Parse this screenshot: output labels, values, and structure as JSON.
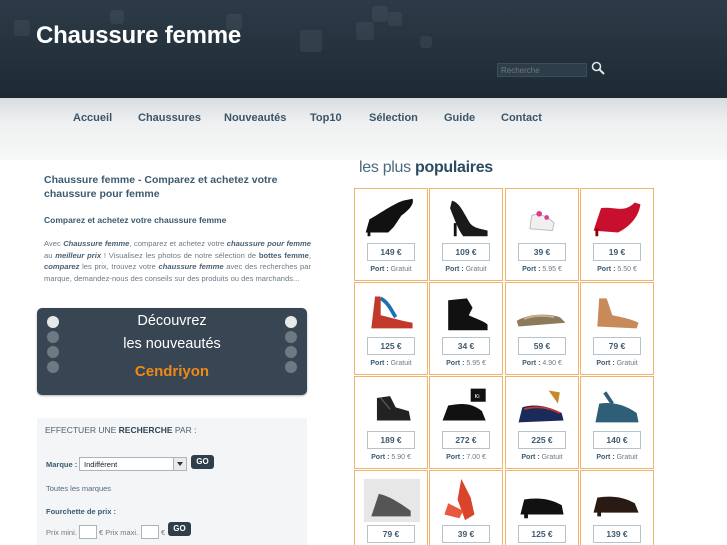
{
  "header": {
    "title": "Chaussure femme",
    "search_placeholder": "Recherche"
  },
  "nav": [
    "Accueil",
    "Chaussures",
    "Nouveautés",
    "Top10",
    "Sélection",
    "Guide",
    "Contact"
  ],
  "intro": {
    "title": "Chaussure femme - Comparez et achetez votre chaussure pour femme",
    "subtitle": "Comparez et achetez votre chaussure femme",
    "p1": "Avec ",
    "b1": "Chaussure femme",
    "p2": ", comparez et achetez votre ",
    "b2": "chaussure pour femme",
    "p3": " au ",
    "b3": "meilleur prix",
    "p4": " ! Visualisez les photos de notre sélection de ",
    "b4": "bottes femme",
    "p5": ", ",
    "b5": "comparez",
    "p6": " les prix, trouvez votre ",
    "b6": "chaussure femme",
    "p7": " avec des recherches par marque, demandez-nous des conseils sur des produits ou des marchands..."
  },
  "promo": {
    "line1": "Découvrez",
    "line2": "les nouveautés",
    "brand": "Cendriyon"
  },
  "search_panel": {
    "title_pre": "EFFECTUER UNE ",
    "title_bold": "RECHERCHE",
    "title_post": " PAR :",
    "marque_label": "Marque :",
    "marque_value": "Indifférent",
    "go_label": "GO",
    "all_brands": "Toutes les marques",
    "price_label": "Fourchette de prix :",
    "prix_mini": "Prix mini.",
    "prix_maxi": "€ Prix maxi.",
    "euro": "€"
  },
  "popular": {
    "title_light": "les plus ",
    "title_bold": "populaires",
    "port_label": "Port :",
    "products": [
      {
        "price": "149 €",
        "port": "Gratuit"
      },
      {
        "price": "109 €",
        "port": "Gratuit"
      },
      {
        "price": "39 €",
        "port": "5.95 €"
      },
      {
        "price": "19 €",
        "port": "5.50 €"
      },
      {
        "price": "125 €",
        "port": "Gratuit"
      },
      {
        "price": "34 €",
        "port": "5.95 €"
      },
      {
        "price": "59 €",
        "port": "4.90 €"
      },
      {
        "price": "79 €",
        "port": "Gratuit"
      },
      {
        "price": "189 €",
        "port": "5.90 €"
      },
      {
        "price": "272 €",
        "port": "7.00 €"
      },
      {
        "price": "225 €",
        "port": "Gratuit"
      },
      {
        "price": "140 €",
        "port": "Gratuit"
      },
      {
        "price": "79 €",
        "port": ""
      },
      {
        "price": "39 €",
        "port": ""
      },
      {
        "price": "125 €",
        "port": ""
      },
      {
        "price": "139 €",
        "port": ""
      }
    ]
  },
  "colors": {
    "header_bg": "#24323d",
    "nav_text": "#3b5569",
    "card_border": "#f0b46a",
    "promo_brand": "#f08a16"
  }
}
